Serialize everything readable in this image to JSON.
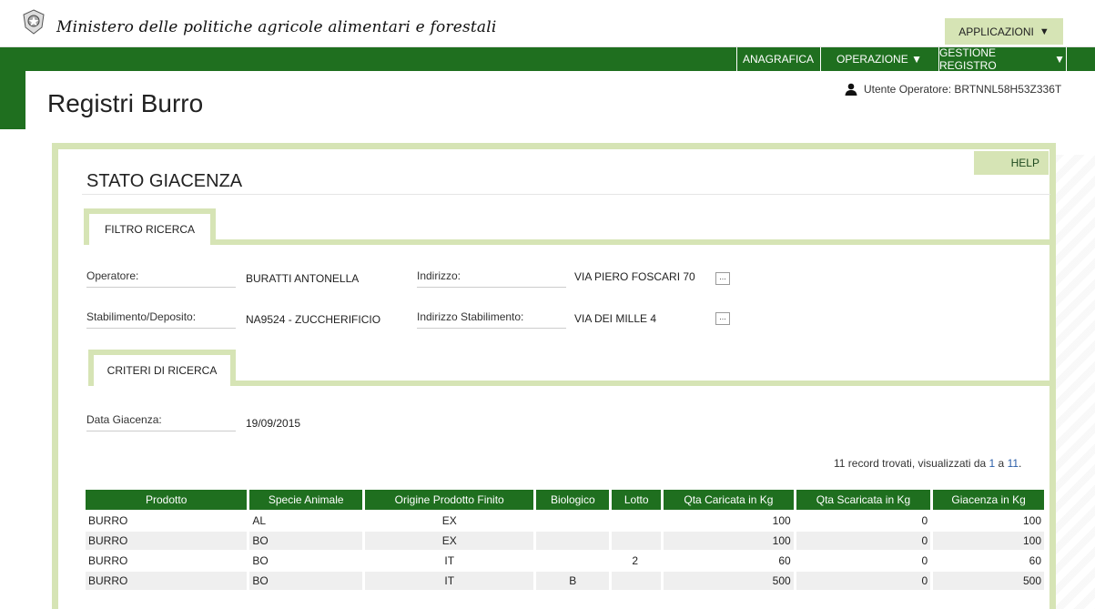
{
  "header": {
    "ministry": "Ministero delle politiche agricole alimentari e forestali",
    "apps_label": "APPLICAZIONI",
    "emblem_icon": "emblem-icon"
  },
  "nav": {
    "anagrafica": "ANAGRAFICA",
    "operazione": "OPERAZIONE",
    "gestione": "GESTIONE REGISTRO"
  },
  "page": {
    "title": "Registri Burro",
    "user_label": "Utente Operatore: BRTNNL58H53Z336T"
  },
  "panel": {
    "help": "HELP",
    "section_title": "STATO GIACENZA",
    "tab_filter": "FILTRO RICERCA",
    "tab_criteria": "CRITERI DI RICERCA"
  },
  "filter": {
    "operatore_label": "Operatore:",
    "operatore_value": "BURATTI ANTONELLA",
    "indirizzo_label": "Indirizzo:",
    "indirizzo_value": "VIA PIERO FOSCARI 70",
    "stab_label": "Stabilimento/Deposito:",
    "stab_value": "NA9524 - ZUCCHERIFICIO",
    "ind_stab_label": "Indirizzo Stabilimento:",
    "ind_stab_value": "VIA DEI MILLE 4",
    "dots": "..."
  },
  "criteria": {
    "data_label": "Data Giacenza:",
    "data_value": "19/09/2015"
  },
  "records": {
    "prefix": "11 record trovati, visualizzati da ",
    "from": "1",
    "mid": " a ",
    "to": "11",
    "suffix": "."
  },
  "table": {
    "headers": [
      "Prodotto",
      "Specie Animale",
      "Origine Prodotto Finito",
      "Biologico",
      "Lotto",
      "Qta Caricata in Kg",
      "Qta Scaricata in Kg",
      "Giacenza in Kg"
    ],
    "rows": [
      [
        "BURRO",
        "AL",
        "EX",
        "",
        "",
        "100",
        "0",
        "100"
      ],
      [
        "BURRO",
        "BO",
        "EX",
        "",
        "",
        "100",
        "0",
        "100"
      ],
      [
        "BURRO",
        "BO",
        "IT",
        "",
        "2",
        "60",
        "0",
        "60"
      ],
      [
        "BURRO",
        "BO",
        "IT",
        "B",
        "",
        "500",
        "0",
        "500"
      ]
    ]
  },
  "colors": {
    "green": "#1f6f1f",
    "light_green": "#d6e4b5"
  }
}
